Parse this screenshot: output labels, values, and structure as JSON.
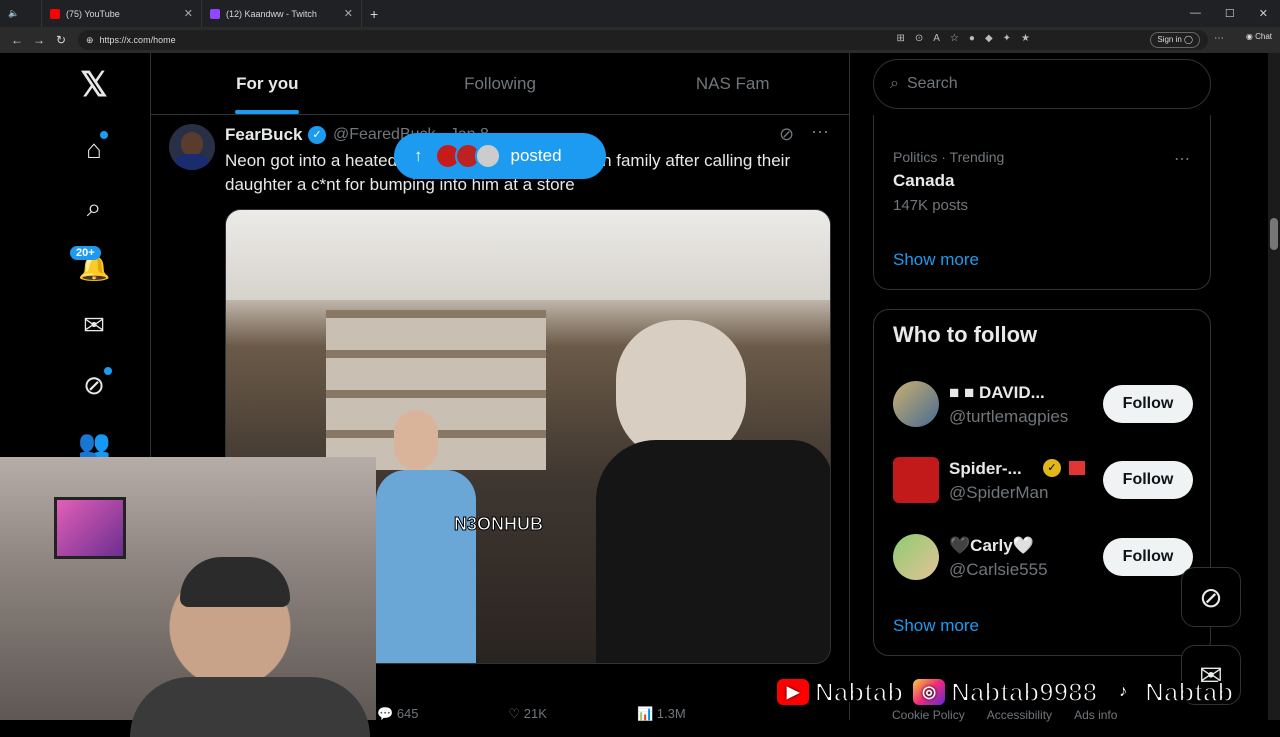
{
  "browser": {
    "tabs": [
      {
        "label": "(75) YouTube",
        "color": "#ff0000"
      },
      {
        "label": "(12) Kaandww - Twitch",
        "color": "#9146ff"
      }
    ],
    "url": "https://x.com/home",
    "signin_label": "Sign in",
    "chat_label": "Chat"
  },
  "nav": {
    "notifications_badge": "20+"
  },
  "feed": {
    "tabs": [
      "For you",
      "Following",
      "NAS Fam"
    ],
    "posted_label": "posted",
    "post": {
      "author": "FearBuck",
      "handle": "@FearedBuck · Jan 8",
      "text": "Neon got into a heated argument with an Australian family after calling their daughter a c*nt for bumping into him at a store",
      "watermark": "N3ONHUB",
      "replies": "645",
      "reposts": "21K",
      "views": "1.3M"
    }
  },
  "right": {
    "search_placeholder": "Search",
    "trend_meta": "Politics · Trending",
    "trend_name": "Canada",
    "trend_posts": "147K posts",
    "show_more": "Show more",
    "wtf_title": "Who to follow",
    "follow_label": "Follow",
    "suggestions": [
      {
        "name": "■ ■ DAVID...",
        "handle": "@turtlemagpies"
      },
      {
        "name": "Spider-...",
        "handle": "@SpiderMan"
      },
      {
        "name": "🖤Carly🤍",
        "handle": "@Carlsie555"
      }
    ],
    "footer": [
      "Cookie Policy",
      "Accessibility",
      "Ads info"
    ]
  },
  "overlay": {
    "youtube": "Nabtab",
    "instagram": "Nabtab9988",
    "tiktok": "Nabtab"
  },
  "colors": {
    "accent": "#1d9bf0",
    "bg": "#000000"
  }
}
